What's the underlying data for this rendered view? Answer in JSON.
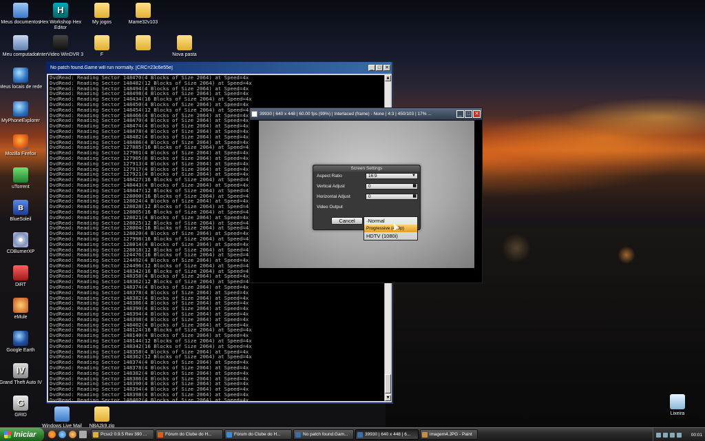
{
  "desktop": {
    "icons": [
      {
        "label": "Meus documentos",
        "icon": "documents-icon"
      },
      {
        "label": "Hex Workshop Hex Editor",
        "icon": "hex-editor-icon"
      },
      {
        "label": "My jogos",
        "icon": "folder-icon"
      },
      {
        "label": "Mame32v103",
        "icon": "folder-icon"
      },
      {
        "label": "Meu computador",
        "icon": "computer-icon"
      },
      {
        "label": "InterVideo WinDVR 3",
        "icon": "windvr-icon"
      },
      {
        "label": "F",
        "icon": "folder-icon"
      },
      {
        "label": "",
        "icon": "folder-icon"
      },
      {
        "label": "Nova pasta",
        "icon": "folder-icon"
      },
      {
        "label": "Meus locais de rede",
        "icon": "network-icon"
      },
      {
        "label": "MyPhoneExplorer",
        "icon": "phone-explorer-icon"
      },
      {
        "label": "Mozilla Firefox",
        "icon": "firefox-icon"
      },
      {
        "label": "uTorrent",
        "icon": "utorrent-icon"
      },
      {
        "label": "BlueSoleil",
        "icon": "bluetooth-icon"
      },
      {
        "label": "CDBurnerXP",
        "icon": "cdburner-icon"
      },
      {
        "label": "DiRT",
        "icon": "dirt-icon"
      },
      {
        "label": "eMule",
        "icon": "emule-icon"
      },
      {
        "label": "Google Earth",
        "icon": "google-earth-icon"
      },
      {
        "label": "Grand Theft Auto IV",
        "icon": "gta-icon"
      },
      {
        "label": "GRID",
        "icon": "grid-icon"
      },
      {
        "label": "Windows Live Mail",
        "icon": "live-mail-icon"
      },
      {
        "label": "NBA2k9.zip",
        "icon": "zip-icon"
      },
      {
        "label": "Lixeira",
        "icon": "recycle-bin-icon"
      }
    ]
  },
  "console_window": {
    "title": "No patch found.Game will run normally. [CRC=23c6e55e]",
    "lines": [
      "DvdRead: Reading Sector 148470(4 Blocks of Size 2064) at Speed=4x",
      "DvdRead: Reading Sector 148482(12 Blocks of Size 2064) at Speed=4x",
      "DvdRead: Reading Sector 148494(4 Blocks of Size 2064) at Speed=4x",
      "DvdRead: Reading Sector 148498(4 Blocks of Size 2064) at Speed=4x",
      "DvdRead: Reading Sector 148434(16 Blocks of Size 2064) at Speed=4x",
      "DvdRead: Reading Sector 148450(4 Blocks of Size 2064) at Speed=4x",
      "DvdRead: Reading Sector 148454(12 Blocks of Size 2064) at Speed=4x",
      "DvdRead: Reading Sector 148466(4 Blocks of Size 2064) at Speed=4x",
      "DvdRead: Reading Sector 148470(4 Blocks of Size 2064) at Speed=4x",
      "DvdRead: Reading Sector 148474(4 Blocks of Size 2064) at Speed=4x",
      "DvdRead: Reading Sector 148478(4 Blocks of Size 2064) at Speed=4x",
      "DvdRead: Reading Sector 148482(4 Blocks of Size 2064) at Speed=4x",
      "DvdRead: Reading Sector 148486(4 Blocks of Size 2064) at Speed=4x",
      "DvdRead: Reading Sector 127885(16 Blocks of Size 2064) at Speed=4x",
      "DvdRead: Reading Sector 127901(4 Blocks of Size 2064) at Speed=4x",
      "DvdRead: Reading Sector 127905(8 Blocks of Size 2064) at Speed=4x",
      "DvdRead: Reading Sector 127913(4 Blocks of Size 2064) at Speed=4x",
      "DvdRead: Reading Sector 127917(4 Blocks of Size 2064) at Speed=4x",
      "DvdRead: Reading Sector 127921(4 Blocks of Size 2064) at Speed=4x",
      "DvdRead: Reading Sector 148427(16 Blocks of Size 2064) at Speed=4x",
      "DvdRead: Reading Sector 148443(4 Blocks of Size 2064) at Speed=4x",
      "DvdRead: Reading Sector 148447(12 Blocks of Size 2064) at Speed=4x",
      "DvdRead: Reading Sector 128000(16 Blocks of Size 2064) at Speed=4x",
      "DvdRead: Reading Sector 128024(4 Blocks of Size 2064) at Speed=4x",
      "DvdRead: Reading Sector 128028(12 Blocks of Size 2064) at Speed=4x",
      "DvdRead: Reading Sector 128005(16 Blocks of Size 2064) at Speed=4x",
      "DvdRead: Reading Sector 128021(4 Blocks of Size 2064) at Speed=4x",
      "DvdRead: Reading Sector 128025(12 Blocks of Size 2064) at Speed=4x",
      "DvdRead: Reading Sector 128004(16 Blocks of Size 2064) at Speed=4x",
      "DvdRead: Reading Sector 128020(4 Blocks of Size 2064) at Speed=4x",
      "DvdRead: Reading Sector 127998(16 Blocks of Size 2064) at Speed=4x",
      "DvdRead: Reading Sector 128014(4 Blocks of Size 2064) at Speed=4x",
      "DvdRead: Reading Sector 128018(12 Blocks of Size 2064) at Speed=4x",
      "DvdRead: Reading Sector 124476(16 Blocks of Size 2064) at Speed=4x",
      "DvdRead: Reading Sector 124492(4 Blocks of Size 2064) at Speed=4x",
      "DvdRead: Reading Sector 124496(12 Blocks of Size 2064) at Speed=4x",
      "DvdRead: Reading Sector 148342(16 Blocks of Size 2064) at Speed=4x",
      "DvdRead: Reading Sector 148358(4 Blocks of Size 2064) at Speed=4x",
      "DvdRead: Reading Sector 148362(12 Blocks of Size 2064) at Speed=4x",
      "DvdRead: Reading Sector 148374(4 Blocks of Size 2064) at Speed=4x",
      "DvdRead: Reading Sector 148378(4 Blocks of Size 2064) at Speed=4x",
      "DvdRead: Reading Sector 148382(4 Blocks of Size 2064) at Speed=4x",
      "DvdRead: Reading Sector 148386(4 Blocks of Size 2064) at Speed=4x",
      "DvdRead: Reading Sector 148390(4 Blocks of Size 2064) at Speed=4x",
      "DvdRead: Reading Sector 148394(4 Blocks of Size 2064) at Speed=4x",
      "DvdRead: Reading Sector 148398(4 Blocks of Size 2064) at Speed=4x",
      "DvdRead: Reading Sector 148402(4 Blocks of Size 2064) at Speed=4x",
      "DvdRead: Reading Sector 148124(16 Blocks of Size 2064) at Speed=4x",
      "DvdRead: Reading Sector 148140(4 Blocks of Size 2064) at Speed=4x",
      "DvdRead: Reading Sector 148144(12 Blocks of Size 2064) at Speed=4x",
      "DvdRead: Reading Sector 148342(16 Blocks of Size 2064) at Speed=4x",
      "DvdRead: Reading Sector 148358(4 Blocks of Size 2064) at Speed=4x",
      "DvdRead: Reading Sector 148362(12 Blocks of Size 2064) at Speed=4x",
      "DvdRead: Reading Sector 148374(4 Blocks of Size 2064) at Speed=4x",
      "DvdRead: Reading Sector 148378(4 Blocks of Size 2064) at Speed=4x",
      "DvdRead: Reading Sector 148382(4 Blocks of Size 2064) at Speed=4x",
      "DvdRead: Reading Sector 148386(4 Blocks of Size 2064) at Speed=4x",
      "DvdRead: Reading Sector 148390(4 Blocks of Size 2064) at Speed=4x",
      "DvdRead: Reading Sector 148394(4 Blocks of Size 2064) at Speed=4x",
      "DvdRead: Reading Sector 148398(4 Blocks of Size 2064) at Speed=4x",
      "DvdRead: Reading Sector 148402(4 Blocks of Size 2064) at Speed=4x",
      "DvdRead: Reading Sector 148398(16 Blocks of Size 2064) at Speed=4x",
      "DvdRead: Reading Sector 148414(4 Blocks of Size 2064) at Speed=4x",
      "DvdRead: Reading Sector 148418(12 Blocks of Size 2064) at Speed=4x"
    ]
  },
  "game_window": {
    "title": "39930 | 640 x 448 | 60.00 fps (99%) | Interlaced (frame) - None | 4:3 | 450/103 | 17% ..."
  },
  "screen_settings": {
    "title": "Screen Settings",
    "aspect_ratio_label": "Aspect Ratio",
    "aspect_ratio_value": "16:9",
    "vertical_adjust_label": "Vertical Adjust",
    "vertical_adjust_value": "0",
    "horizontal_adjust_label": "Horizontal Adjust",
    "horizontal_adjust_value": "0",
    "video_output_label": "Video Output",
    "cancel_label": "Cancel",
    "video_output_options": [
      "·Normal",
      "Progressive (480p)",
      "HDTV (1080i)"
    ],
    "selected_option_index": 1
  },
  "taskbar": {
    "start_label": "Iniciar",
    "tasks": [
      {
        "label": "Pcsx2 0.9.5 Rev 390 ...",
        "icon": "folder-icon",
        "color": "#e0b030"
      },
      {
        "label": "Fórum do Clube do H...",
        "icon": "firefox-icon",
        "color": "#e05a10"
      },
      {
        "label": "Fórum do Clube do H...",
        "icon": "ie-icon",
        "color": "#3a8ae0"
      },
      {
        "label": "No patch found.Gam...",
        "icon": "console-icon",
        "color": "#3a6ea5"
      },
      {
        "label": "39930 | 640 x 448 | 6...",
        "icon": "game-window-icon",
        "color": "#3a6ea5"
      },
      {
        "label": "imagem4.JPG - Paint",
        "icon": "paint-icon",
        "color": "#c09040"
      }
    ],
    "active_task_index": 4,
    "clock": "00:01"
  }
}
